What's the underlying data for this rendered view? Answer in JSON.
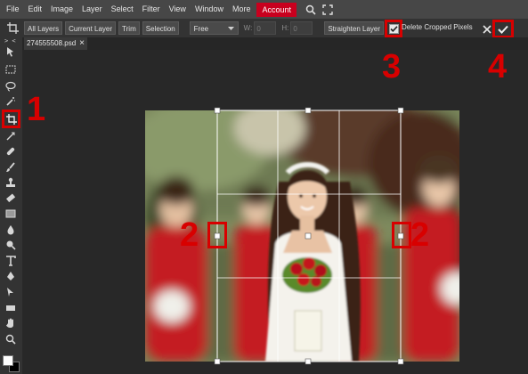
{
  "menubar": {
    "items": [
      "File",
      "Edit",
      "Image",
      "Layer",
      "Select",
      "Filter",
      "View",
      "Window",
      "More",
      "Account"
    ],
    "active_index": 9,
    "icons": [
      "search-icon",
      "fullscreen-icon"
    ]
  },
  "options": {
    "tool_icon": "crop-icon",
    "all_layers": "All Layers",
    "current_layer": "Current Layer",
    "trim": "Trim",
    "selection": "Selection",
    "ratio_select": "Free",
    "w_label": "W:",
    "w_value": "0",
    "h_label": "H:",
    "h_value": "0",
    "straighten": "Straighten Layer",
    "delete_cropped": "Delete Cropped Pixels",
    "delete_cropped_checked": true,
    "cancel_icon": "close-icon",
    "confirm_icon": "checkmark-icon"
  },
  "tabs": [
    {
      "label": "274555508.psd",
      "close": "×"
    }
  ],
  "toolbar": {
    "collapse": "> <",
    "tools": [
      "move-icon",
      "marquee-icon",
      "lasso-icon",
      "magic-wand-icon",
      "crop-icon",
      "slice-icon",
      "healing-icon",
      "brush-icon",
      "stamp-icon",
      "eraser-icon",
      "gradient-icon",
      "blur-icon",
      "dodge-icon",
      "text-icon",
      "pen-icon",
      "path-select-icon",
      "rectangle-icon",
      "hand-icon",
      "zoom-icon"
    ]
  },
  "annotations": {
    "step1": "1",
    "step2_left": "2",
    "step2_right": "2",
    "step3": "3",
    "step4": "4"
  },
  "colors": {
    "annotation": "#d80000",
    "account_bg": "#c8001e",
    "menubar_bg": "#474747",
    "workspace_bg": "#282828"
  }
}
